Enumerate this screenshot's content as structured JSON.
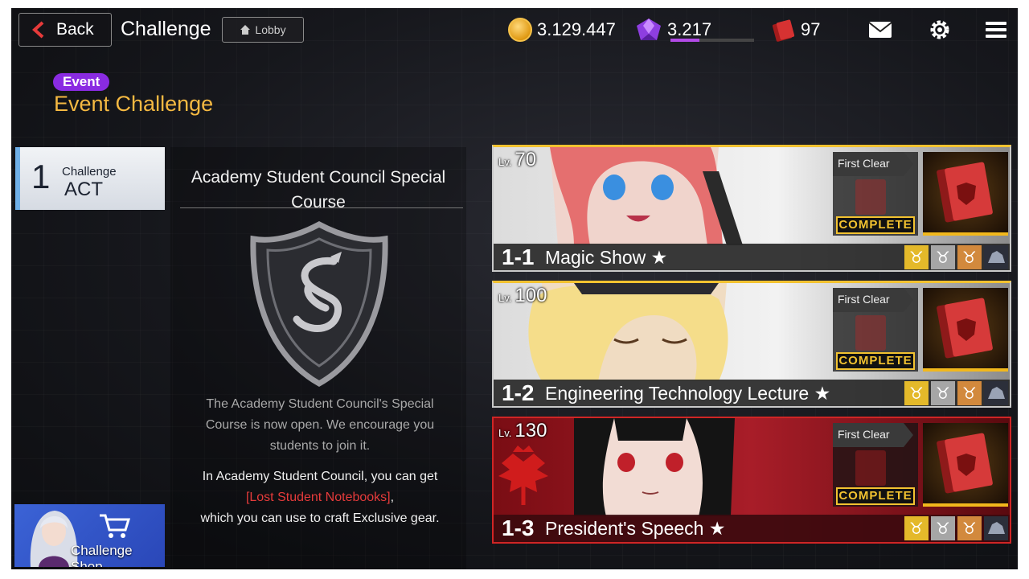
{
  "topbar": {
    "back_label": "Back",
    "title": "Challenge",
    "lobby_label": "Lobby",
    "gold": "3.129.447",
    "gems": "3.217",
    "gem_progress": 0.35,
    "books": "97"
  },
  "event": {
    "badge": "Event",
    "title": "Event Challenge"
  },
  "act": {
    "number": "1",
    "label": "Challenge",
    "name": "ACT"
  },
  "course": {
    "title": "Academy Student Council Special Course",
    "desc1": "The Academy Student Council's Special Course is now open. We encourage you students to join it.",
    "desc2_a": "In Academy Student Council, you can get",
    "desc2_highlight": "[Lost Student Notebooks]",
    "desc2_b": ",",
    "desc2_c": "which you can use to craft Exclusive gear."
  },
  "shop": {
    "label": "Challenge Shop"
  },
  "stages": [
    {
      "lv_tag": "Lv.",
      "level": "70",
      "number": "1-1",
      "name": "Magic Show",
      "first_clear": "First Clear",
      "status": "COMPLETE"
    },
    {
      "lv_tag": "Lv.",
      "level": "100",
      "number": "1-2",
      "name": "Engineering Technology Lecture",
      "first_clear": "First Clear",
      "status": "COMPLETE"
    },
    {
      "lv_tag": "Lv.",
      "level": "130",
      "number": "1-3",
      "name": "President's Speech",
      "first_clear": "First Clear",
      "status": "COMPLETE"
    }
  ],
  "colors": {
    "accent_gold": "#f5b942",
    "event_purple": "#8a2be2",
    "highlight_red": "#e53b3b",
    "stage_red": "#a81d28"
  },
  "icons": {
    "back": "chevron-left-icon",
    "lobby": "home-icon",
    "gold": "coin-icon",
    "gem": "gem-icon",
    "book": "notebook-icon",
    "mail": "mail-icon",
    "settings": "gear-icon",
    "menu": "menu-icon",
    "shop": "cart-icon",
    "star": "star-icon"
  }
}
